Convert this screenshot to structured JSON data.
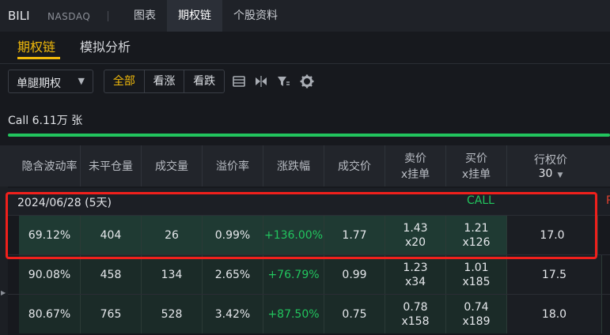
{
  "header": {
    "ticker": "BILI",
    "exchange": "NASDAQ",
    "tabs": [
      {
        "label": "图表",
        "active": false
      },
      {
        "label": "期权链",
        "active": true
      },
      {
        "label": "个股资料",
        "active": false
      }
    ]
  },
  "subtabs": [
    {
      "label": "期权链",
      "active": true
    },
    {
      "label": "模拟分析",
      "active": false
    }
  ],
  "toolbar": {
    "strategy": "单腿期权",
    "filters": [
      {
        "label": "全部",
        "active": true
      },
      {
        "label": "看涨",
        "active": false
      },
      {
        "label": "看跌",
        "active": false
      }
    ],
    "icons": [
      "list-view-icon",
      "split-view-icon",
      "filter-icon",
      "settings-icon"
    ]
  },
  "call_summary": {
    "label": "Call 6.11万 张",
    "call_ratio": 1.0
  },
  "table": {
    "columns": [
      {
        "l1": "隐含波动率",
        "l2": ""
      },
      {
        "l1": "未平仓量",
        "l2": ""
      },
      {
        "l1": "成交量",
        "l2": ""
      },
      {
        "l1": "溢价率",
        "l2": ""
      },
      {
        "l1": "涨跌幅",
        "l2": ""
      },
      {
        "l1": "成交价",
        "l2": ""
      },
      {
        "l1": "卖价",
        "l2": "x挂单"
      },
      {
        "l1": "买价",
        "l2": "x挂单"
      }
    ],
    "strike_header": {
      "label": "行权价",
      "count": "30"
    },
    "expiry": {
      "label": "2024/06/28 (5天)",
      "call_label": "CALL",
      "put_hint": "P"
    },
    "rows": [
      {
        "iv": "69.12%",
        "oi": "404",
        "volume": "26",
        "premium": "0.99%",
        "change": "+136.00%",
        "last": "1.77",
        "ask": "1.43",
        "ask_size": "x20",
        "bid": "1.21",
        "bid_size": "x126",
        "strike": "17.0"
      },
      {
        "iv": "90.08%",
        "oi": "458",
        "volume": "134",
        "premium": "2.65%",
        "change": "+76.79%",
        "last": "0.99",
        "ask": "1.23",
        "ask_size": "x34",
        "bid": "1.01",
        "bid_size": "x185",
        "strike": "17.5"
      },
      {
        "iv": "80.67%",
        "oi": "765",
        "volume": "528",
        "premium": "3.42%",
        "change": "+87.50%",
        "last": "0.75",
        "ask": "0.78",
        "ask_size": "x158",
        "bid": "0.74",
        "bid_size": "x189",
        "strike": "18.0"
      }
    ]
  },
  "colors": {
    "accent": "#f0b90b",
    "positive": "#22c55e",
    "highlight": "#f0201c"
  }
}
